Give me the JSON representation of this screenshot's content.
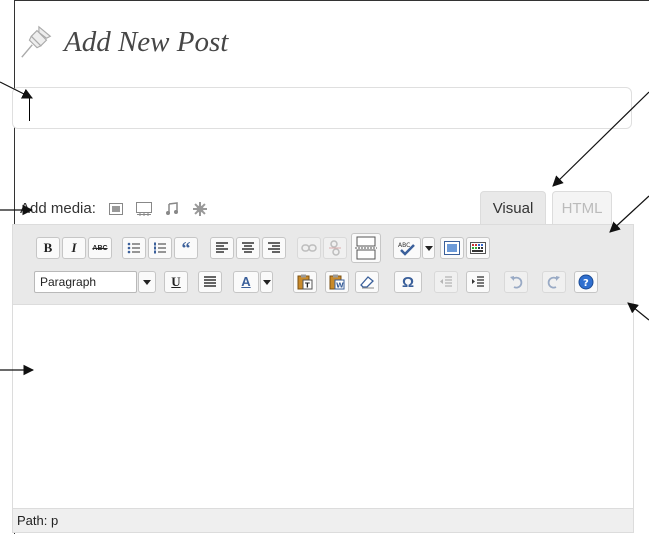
{
  "header": {
    "title": "Add New Post",
    "icon": "pushpin-icon"
  },
  "title_field": {
    "value": ""
  },
  "media": {
    "label": "Add media:",
    "icons": [
      "add-image-icon",
      "add-video-icon",
      "add-audio-icon",
      "add-media-icon"
    ]
  },
  "tabs": [
    {
      "label": "Visual",
      "active": true
    },
    {
      "label": "HTML",
      "active": false
    }
  ],
  "toolbar": {
    "bold": "B",
    "italic": "I",
    "strikethrough": "ABC",
    "blockquote": "“",
    "underline": "U",
    "text_color": "A",
    "special_char": "Ω",
    "format_select": "Paragraph"
  },
  "statusbar": {
    "path": "Path: p"
  },
  "colors": {
    "accent": "#21759b",
    "toolbar_bg": "#e9e9e9"
  }
}
